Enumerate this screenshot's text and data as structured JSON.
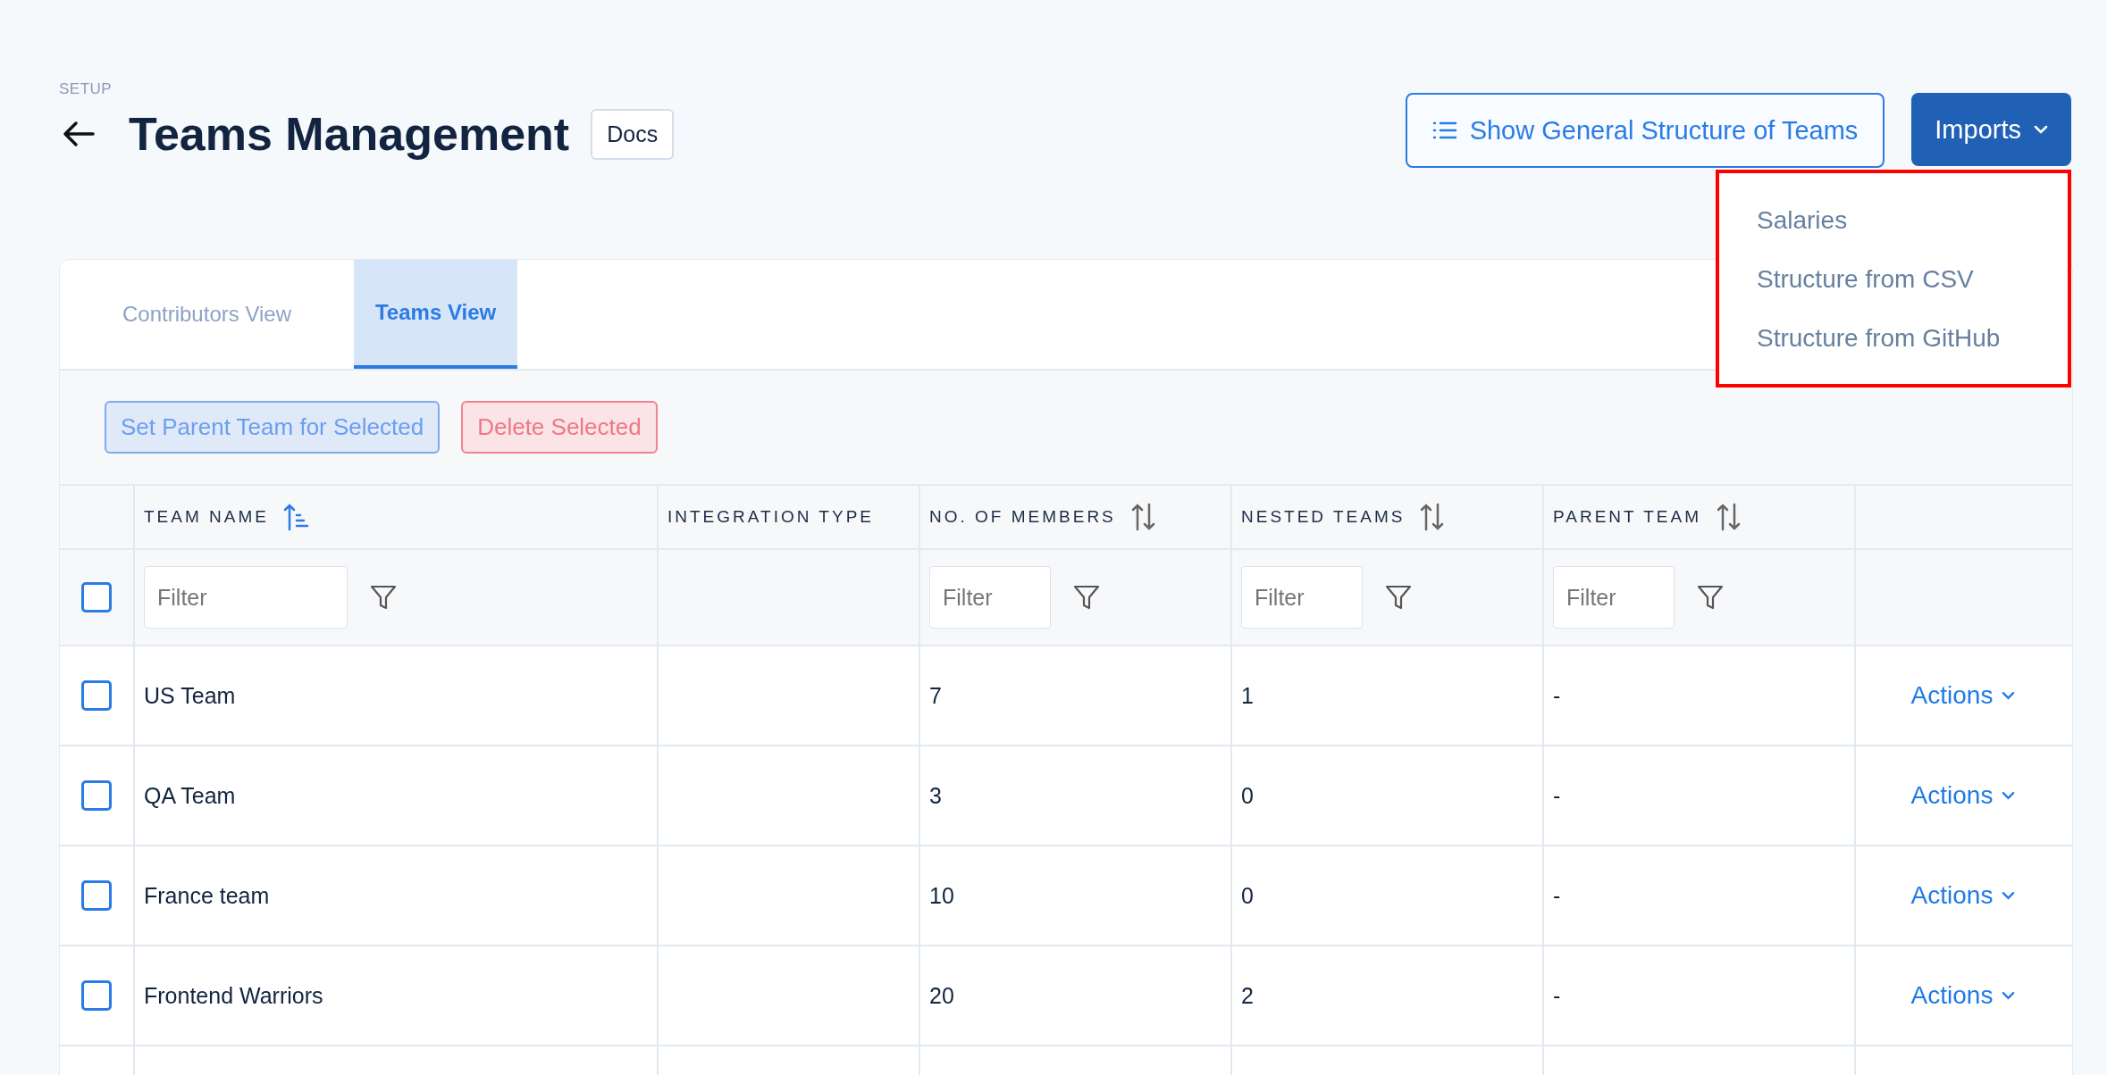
{
  "breadcrumb": "SETUP",
  "title": "Teams Management",
  "docs_button": "Docs",
  "structure_button": "Show General Structure of Teams",
  "imports": {
    "label": "Imports",
    "expanded": true,
    "items": [
      "Salaries",
      "Structure from CSV",
      "Structure from GitHub"
    ]
  },
  "tabs": [
    {
      "label": "Contributors View",
      "selected": false
    },
    {
      "label": "Teams View",
      "selected": true
    }
  ],
  "bulk_actions": [
    {
      "label": "Set Parent Team for Selected",
      "kind": "primary"
    },
    {
      "label": "Delete Selected",
      "kind": "danger"
    }
  ],
  "table": {
    "select_all_checked": false,
    "columns": [
      {
        "label": "TEAM NAME",
        "sortable": true,
        "sorted": true,
        "filter": {
          "placeholder": "Filter"
        }
      },
      {
        "label": "INTEGRATION TYPE",
        "sortable": false
      },
      {
        "label": "NO. OF MEMBERS",
        "sortable": true,
        "sorted": false,
        "filter": {
          "placeholder": "Filter"
        }
      },
      {
        "label": "NESTED TEAMS",
        "sortable": true,
        "sorted": false,
        "filter": {
          "placeholder": "Filter"
        }
      },
      {
        "label": "PARENT TEAM",
        "sortable": true,
        "sorted": false,
        "filter": {
          "placeholder": "Filter"
        }
      }
    ],
    "rows": [
      {
        "checked": false,
        "cells": [
          "US Team",
          "",
          "7",
          "1",
          "-"
        ],
        "action": "Actions"
      },
      {
        "checked": false,
        "cells": [
          "QA Team",
          "",
          "3",
          "0",
          "-"
        ],
        "action": "Actions"
      },
      {
        "checked": false,
        "cells": [
          "France team",
          "",
          "10",
          "0",
          "-"
        ],
        "action": "Actions"
      },
      {
        "checked": false,
        "cells": [
          "Frontend Warriors",
          "",
          "20",
          "2",
          "-"
        ],
        "action": "Actions"
      }
    ]
  }
}
